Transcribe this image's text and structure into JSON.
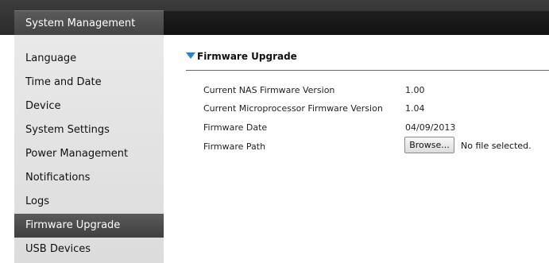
{
  "sidebar": {
    "title": "System Management",
    "items": [
      {
        "label": "Language"
      },
      {
        "label": "Time and Date"
      },
      {
        "label": "Device"
      },
      {
        "label": "System Settings"
      },
      {
        "label": "Power Management"
      },
      {
        "label": "Notifications"
      },
      {
        "label": "Logs"
      },
      {
        "label": "Firmware Upgrade",
        "active": true
      },
      {
        "label": "USB Devices"
      }
    ]
  },
  "section": {
    "title": "Firmware Upgrade",
    "rows": [
      {
        "label": "Current NAS Firmware Version",
        "value": "1.00"
      },
      {
        "label": "Current Microprocessor Firmware Version",
        "value": "1.04"
      },
      {
        "label": "Firmware Date",
        "value": "04/09/2013"
      },
      {
        "label": "Firmware Path"
      }
    ],
    "browse_label": "Browse...",
    "file_status": "No file selected."
  },
  "colors": {
    "accent_arrow": "#2b7fd4",
    "active_item_bg": "#4a4a4a",
    "header_bg": "#2a2a2a"
  }
}
